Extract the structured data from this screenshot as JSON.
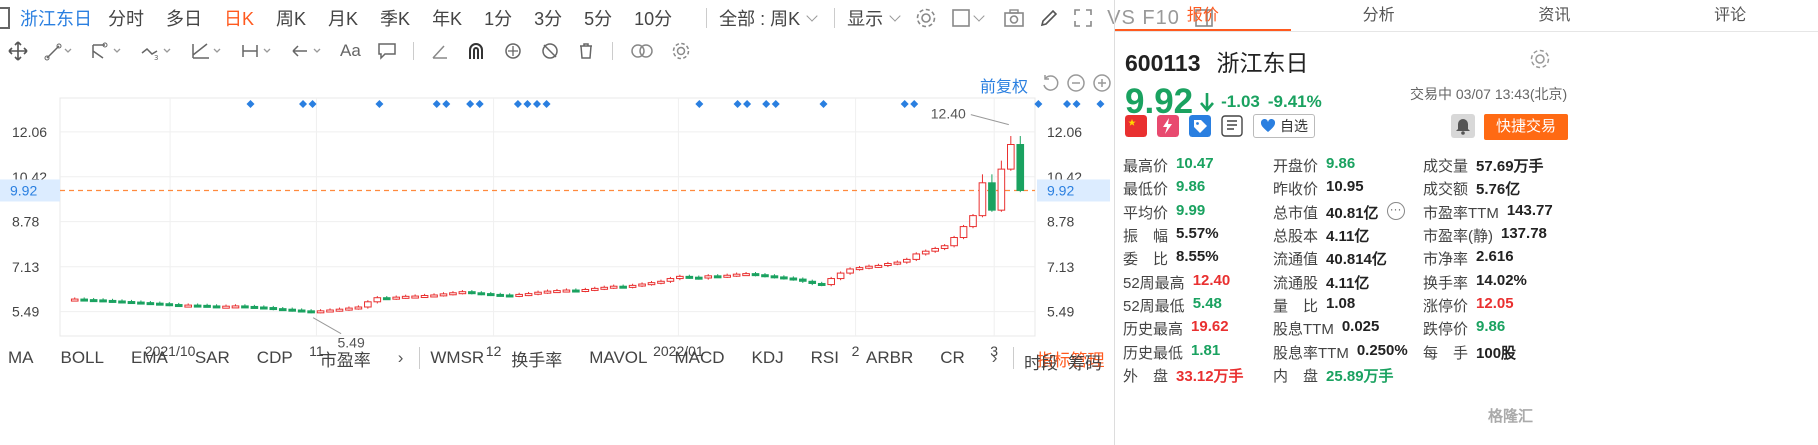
{
  "toolbar": {
    "stock_name": "浙江东日",
    "periods": [
      {
        "label": "分时"
      },
      {
        "label": "多日"
      },
      {
        "label": "日K",
        "active": true
      },
      {
        "label": "周K"
      },
      {
        "label": "月K"
      },
      {
        "label": "季K"
      },
      {
        "label": "年K"
      },
      {
        "label": "1分"
      },
      {
        "label": "3分"
      },
      {
        "label": "5分"
      },
      {
        "label": "10分"
      }
    ],
    "period_select": "全部 : 周K",
    "display_label": "显示",
    "vs_label": "VS F10"
  },
  "draw_tools": {
    "text_tool": "Aa"
  },
  "chart_links": {
    "adjust": "前复权"
  },
  "indicators": {
    "items": [
      "MA",
      "BOLL",
      "EMA",
      "SAR",
      "CDP",
      "市盈率",
      "WMSR",
      "换手率",
      "MAVOL",
      "MACD",
      "KDJ",
      "RSI",
      "ARBR",
      "CR"
    ],
    "more_label": "›",
    "manage_label": "指标管理",
    "right_labels": [
      "时段",
      "筹码"
    ]
  },
  "chart_data": {
    "type": "candlestick",
    "title": "",
    "xlabel": "",
    "ylabel": "",
    "x_tick_labels": [
      "2021/10",
      "11",
      "12",
      "2022/01",
      "2",
      "3"
    ],
    "y_ticks": [
      5.49,
      7.13,
      8.78,
      10.42,
      12.06
    ],
    "ylim": [
      4.6,
      13.3
    ],
    "current_price_line": 9.92,
    "current_price_label": "9.92",
    "annotations": {
      "high": "12.40",
      "low": "5.49"
    },
    "grid": true,
    "event_marker_count": 24,
    "candles_daily_close": [
      5.95,
      5.93,
      5.92,
      5.9,
      5.88,
      5.86,
      5.84,
      5.82,
      5.8,
      5.78,
      5.75,
      5.72,
      5.73,
      5.72,
      5.7,
      5.68,
      5.69,
      5.7,
      5.68,
      5.66,
      5.64,
      5.6,
      5.58,
      5.55,
      5.52,
      5.49,
      5.52,
      5.55,
      5.58,
      5.62,
      5.66,
      5.85,
      6.0,
      5.98,
      6.02,
      6.05,
      6.06,
      6.08,
      6.1,
      6.14,
      6.18,
      6.22,
      6.18,
      6.15,
      6.12,
      6.1,
      6.08,
      6.12,
      6.15,
      6.2,
      6.24,
      6.26,
      6.28,
      6.26,
      6.3,
      6.34,
      6.38,
      6.42,
      6.4,
      6.45,
      6.5,
      6.55,
      6.6,
      6.7,
      6.78,
      6.75,
      6.72,
      6.8,
      6.78,
      6.82,
      6.86,
      6.88,
      6.84,
      6.8,
      6.76,
      6.72,
      6.68,
      6.6,
      6.52,
      6.48,
      6.7,
      6.9,
      7.05,
      7.1,
      7.15,
      7.18,
      7.25,
      7.3,
      7.4,
      7.6,
      7.7,
      7.8,
      7.9,
      8.2,
      8.6,
      9.0,
      10.2,
      9.2,
      10.7,
      11.6,
      9.92
    ],
    "colors": {
      "up": "#e93030",
      "down": "#1aa260",
      "marker": "#2a7fe0",
      "price_line": "#ff8a3d"
    }
  },
  "panel": {
    "tabs": [
      {
        "label": "报价",
        "active": true
      },
      {
        "label": "分析"
      },
      {
        "label": "资讯"
      },
      {
        "label": "评论"
      }
    ],
    "code": "600113",
    "name": "浙江东日",
    "price": "9.92",
    "change": "-1.03",
    "change_pct": "-9.41%",
    "status": "交易中 03/07 13:43(北京)",
    "watch_label": "自选",
    "fast_trade": "快捷交易",
    "fields": [
      [
        {
          "label": "最高价",
          "value": "10.47",
          "color": "green"
        },
        {
          "label": "开盘价",
          "value": "9.86",
          "color": "green"
        },
        {
          "label": "成交量",
          "value": "57.69万手",
          "color": "dark"
        }
      ],
      [
        {
          "label": "最低价",
          "value": "9.86",
          "color": "green"
        },
        {
          "label": "昨收价",
          "value": "10.95",
          "color": "dark"
        },
        {
          "label": "成交额",
          "value": "5.76亿",
          "color": "dark"
        }
      ],
      [
        {
          "label": "平均价",
          "value": "9.99",
          "color": "green"
        },
        {
          "label": "总市值",
          "value": "40.81亿",
          "color": "dark",
          "dots": true
        },
        {
          "label": "市盈率TTM",
          "value": "143.77",
          "color": "dark"
        }
      ],
      [
        {
          "label": "振　幅",
          "value": "5.57%",
          "color": "dark"
        },
        {
          "label": "总股本",
          "value": "4.11亿",
          "color": "dark"
        },
        {
          "label": "市盈率(静)",
          "value": "137.78",
          "color": "dark"
        }
      ],
      [
        {
          "label": "委　比",
          "value": "8.55%",
          "color": "dark"
        },
        {
          "label": "流通值",
          "value": "40.814亿",
          "color": "dark"
        },
        {
          "label": "市净率",
          "value": "2.616",
          "color": "dark"
        }
      ],
      [
        {
          "label": "52周最高",
          "value": "12.40",
          "color": "red"
        },
        {
          "label": "流通股",
          "value": "4.11亿",
          "color": "dark"
        },
        {
          "label": "换手率",
          "value": "14.02%",
          "color": "dark"
        }
      ],
      [
        {
          "label": "52周最低",
          "value": "5.48",
          "color": "green"
        },
        {
          "label": "量　比",
          "value": "1.08",
          "color": "dark"
        },
        {
          "label": "涨停价",
          "value": "12.05",
          "color": "red"
        }
      ],
      [
        {
          "label": "历史最高",
          "value": "19.62",
          "color": "red"
        },
        {
          "label": "股息TTM",
          "value": "0.025",
          "color": "dark"
        },
        {
          "label": "跌停价",
          "value": "9.86",
          "color": "green"
        }
      ],
      [
        {
          "label": "历史最低",
          "value": "1.81",
          "color": "green"
        },
        {
          "label": "股息率TTM",
          "value": "0.250%",
          "color": "dark"
        },
        {
          "label": "每　手",
          "value": "100股",
          "color": "dark"
        }
      ],
      [
        {
          "label": "外　盘",
          "value": "33.12万手",
          "color": "red"
        },
        {
          "label": "内　盘",
          "value": "25.89万手",
          "color": "green"
        },
        {
          "label": "",
          "value": "",
          "color": "dark"
        }
      ]
    ]
  },
  "watermark": "格隆汇"
}
